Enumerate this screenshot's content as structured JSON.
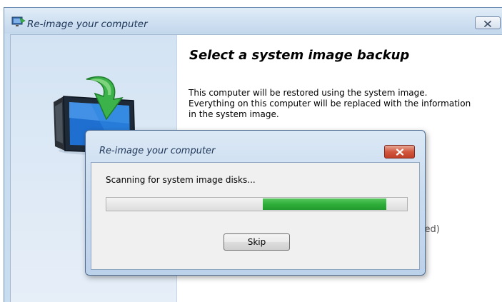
{
  "main_window": {
    "title": "Re-image your computer",
    "heading": "Select a system image backup",
    "description": "This computer will be restored using the system image. Everything on this computer will be replaced with the information in the system image.",
    "partial_text": "nded)",
    "icons": {
      "title_icon": "restore-computer-icon",
      "close": "close-icon",
      "illustration": "monitor-restore-arrow-illustration"
    }
  },
  "dialog": {
    "title": "Re-image your computer",
    "status": "Scanning for system image disks...",
    "progress": {
      "mode": "marquee",
      "segment_start_fraction": 0.52,
      "segment_end_fraction": 0.93
    },
    "skip_label": "Skip",
    "icons": {
      "close": "close-icon"
    }
  },
  "colors": {
    "progress_green": "#2fae3a",
    "dialog_close_red": "#c13f28",
    "title_text": "#1d3557"
  }
}
